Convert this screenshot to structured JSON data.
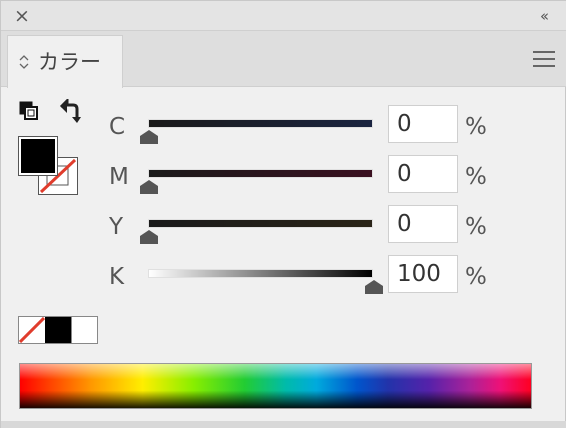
{
  "window": {
    "close_glyph": "×",
    "collapse_glyph": "‹‹"
  },
  "tab": {
    "label": "カラー",
    "chevron": "◇"
  },
  "channels": [
    {
      "label": "C",
      "value": "0",
      "unit": "%",
      "level": 0,
      "track_color_end": "#1a2440"
    },
    {
      "label": "M",
      "value": "0",
      "unit": "%",
      "level": 0,
      "track_color_end": "#3a1020"
    },
    {
      "label": "Y",
      "value": "0",
      "unit": "%",
      "level": 0,
      "track_color_end": "#2a2418"
    },
    {
      "label": "K",
      "value": "100",
      "unit": "%",
      "level": 1,
      "track_color_start": "#ffffff",
      "track_color_end": "#000000"
    }
  ],
  "swatches": {
    "fill_color": "#000000",
    "stroke_color": "none",
    "mini": [
      "none",
      "black",
      "white"
    ]
  },
  "icons": {
    "close": "close-icon",
    "collapse": "double-chevron-left-icon",
    "menu": "hamburger-menu-icon",
    "swap": "swap-fill-stroke-icon",
    "default": "default-fill-stroke-icon"
  },
  "colors": {
    "none_slash": "#e03c2c",
    "panel_bg": "#f0f0f0"
  }
}
